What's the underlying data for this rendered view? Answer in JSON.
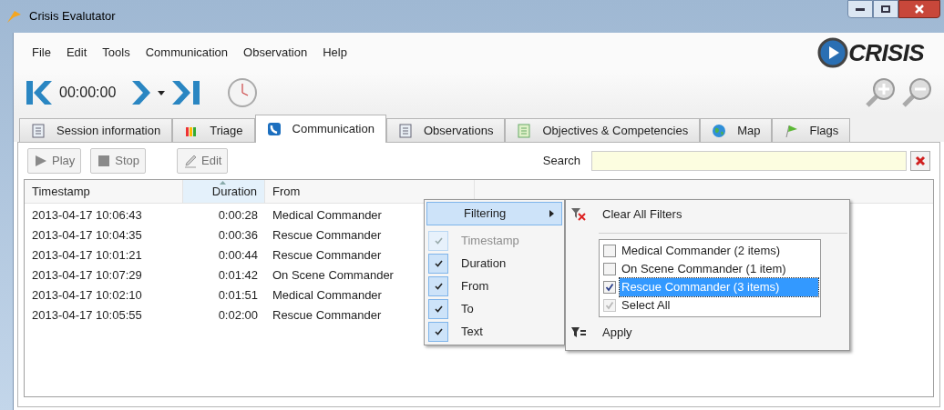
{
  "window": {
    "title": "Crisis Evalutator"
  },
  "menu_bar": [
    "File",
    "Edit",
    "Tools",
    "Communication",
    "Observation",
    "Help"
  ],
  "logo": "CRISIS",
  "toolbar": {
    "time": "00:00:00"
  },
  "tabs": [
    {
      "label": "Session information",
      "selected": false
    },
    {
      "label": "Triage",
      "selected": false
    },
    {
      "label": "Communication",
      "selected": true
    },
    {
      "label": "Observations",
      "selected": false
    },
    {
      "label": "Objectives & Competencies",
      "selected": false
    },
    {
      "label": "Map",
      "selected": false
    },
    {
      "label": "Flags",
      "selected": false
    }
  ],
  "actions": [
    {
      "label": "Play",
      "disabled": true
    },
    {
      "label": "Stop",
      "disabled": true
    },
    {
      "label": "Edit",
      "disabled": true
    }
  ],
  "search": {
    "label": "Search"
  },
  "table": {
    "columns": [
      {
        "label": "Timestamp",
        "sorted": false
      },
      {
        "label": "Duration",
        "sorted": true
      },
      {
        "label": "From",
        "sorted": false
      }
    ],
    "rows": [
      [
        "2013-04-17 10:06:43",
        "0:00:28",
        "Medical Commander"
      ],
      [
        "2013-04-17 10:04:35",
        "0:00:36",
        "Rescue Commander"
      ],
      [
        "2013-04-17 10:01:21",
        "0:00:44",
        "Rescue Commander"
      ],
      [
        "2013-04-17 10:07:29",
        "0:01:42",
        "On Scene Commander"
      ],
      [
        "2013-04-17 10:02:10",
        "0:01:51",
        "Medical Commander"
      ],
      [
        "2013-04-17 10:05:55",
        "0:02:00",
        "Rescue Commander"
      ]
    ]
  },
  "context_menu": {
    "items": [
      {
        "label": "Filtering",
        "kind": "submenu",
        "selected": true
      },
      {
        "label": "Timestamp",
        "kind": "check",
        "checked": true,
        "disabled": true
      },
      {
        "label": "Duration",
        "kind": "check",
        "checked": true,
        "disabled": false
      },
      {
        "label": "From",
        "kind": "check",
        "checked": true,
        "disabled": false
      },
      {
        "label": "To",
        "kind": "check",
        "checked": true,
        "disabled": false
      },
      {
        "label": "Text",
        "kind": "check",
        "checked": true,
        "disabled": false
      }
    ]
  },
  "filter_menu": {
    "clear": "Clear All Filters",
    "values": [
      {
        "label": "Medical Commander (2 items)",
        "checked": false,
        "selected": false,
        "disabled": false
      },
      {
        "label": "On Scene Commander (1 item)",
        "checked": false,
        "selected": false,
        "disabled": false
      },
      {
        "label": "Rescue Commander (3 items)",
        "checked": true,
        "selected": true,
        "disabled": false
      },
      {
        "label": "Select All",
        "checked": true,
        "selected": false,
        "disabled": true
      }
    ],
    "apply": "Apply"
  }
}
